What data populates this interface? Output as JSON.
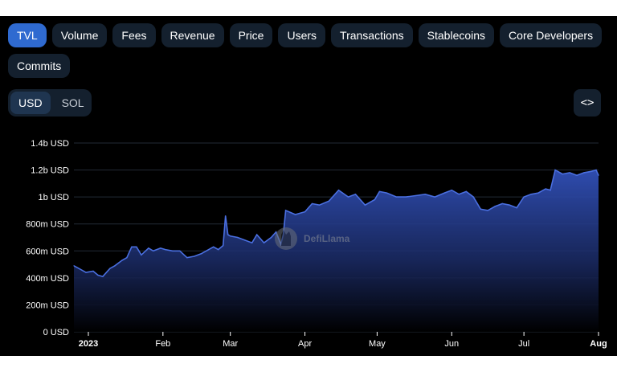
{
  "tabs": [
    {
      "label": "TVL",
      "active": true
    },
    {
      "label": "Volume",
      "active": false
    },
    {
      "label": "Fees",
      "active": false
    },
    {
      "label": "Revenue",
      "active": false
    },
    {
      "label": "Price",
      "active": false
    },
    {
      "label": "Users",
      "active": false
    },
    {
      "label": "Transactions",
      "active": false
    },
    {
      "label": "Stablecoins",
      "active": false
    },
    {
      "label": "Core Developers",
      "active": false
    },
    {
      "label": "Commits",
      "active": false
    }
  ],
  "currency_toggle": {
    "options": [
      "USD",
      "SOL"
    ],
    "selected": "USD"
  },
  "embed_icon": "code-brackets-icon",
  "watermark": {
    "text": "DefiLlama",
    "icon": "llama-logo-icon"
  },
  "colors": {
    "accent": "#2f6ad0",
    "line": "#4a6fe0",
    "fill_top": "#3150b8",
    "grid": "#222a36"
  },
  "chart_data": {
    "type": "area",
    "title": "",
    "xlabel": "",
    "ylabel": "",
    "ylim": [
      0,
      1.4
    ],
    "y_ticks": [
      {
        "value": 0,
        "label": "0 USD"
      },
      {
        "value": 0.2,
        "label": "200m USD"
      },
      {
        "value": 0.4,
        "label": "400m USD"
      },
      {
        "value": 0.6,
        "label": "600m USD"
      },
      {
        "value": 0.8,
        "label": "800m USD"
      },
      {
        "value": 1.0,
        "label": "1b USD"
      },
      {
        "value": 1.2,
        "label": "1.2b USD"
      },
      {
        "value": 1.4,
        "label": "1.4b USD"
      }
    ],
    "y_unit": "billion USD",
    "xlim": [
      "2022-12-26",
      "2023-08-01"
    ],
    "x_ticks": [
      {
        "date": "2023-01-01",
        "label": "2023",
        "bold": true
      },
      {
        "date": "2023-02-01",
        "label": "Feb"
      },
      {
        "date": "2023-03-01",
        "label": "Mar"
      },
      {
        "date": "2023-04-01",
        "label": "Apr"
      },
      {
        "date": "2023-05-01",
        "label": "May"
      },
      {
        "date": "2023-06-01",
        "label": "Jun"
      },
      {
        "date": "2023-07-01",
        "label": "Jul"
      },
      {
        "date": "2023-08-01",
        "label": "Aug",
        "bold": true
      }
    ],
    "grid": true,
    "series": [
      {
        "name": "",
        "x": [
          "2022-12-26",
          "2022-12-28",
          "2022-12-31",
          "2023-01-03",
          "2023-01-05",
          "2023-01-07",
          "2023-01-10",
          "2023-01-12",
          "2023-01-15",
          "2023-01-17",
          "2023-01-19",
          "2023-01-21",
          "2023-01-23",
          "2023-01-26",
          "2023-01-28",
          "2023-01-31",
          "2023-02-02",
          "2023-02-05",
          "2023-02-08",
          "2023-02-11",
          "2023-02-14",
          "2023-02-17",
          "2023-02-19",
          "2023-02-22",
          "2023-02-24",
          "2023-02-26",
          "2023-02-27",
          "2023-02-28",
          "2023-03-01",
          "2023-03-04",
          "2023-03-07",
          "2023-03-10",
          "2023-03-12",
          "2023-03-15",
          "2023-03-18",
          "2023-03-20",
          "2023-03-22",
          "2023-03-23",
          "2023-03-24",
          "2023-03-28",
          "2023-04-01",
          "2023-04-04",
          "2023-04-07",
          "2023-04-11",
          "2023-04-15",
          "2023-04-19",
          "2023-04-22",
          "2023-04-26",
          "2023-04-30",
          "2023-05-02",
          "2023-05-05",
          "2023-05-09",
          "2023-05-13",
          "2023-05-17",
          "2023-05-21",
          "2023-05-25",
          "2023-05-29",
          "2023-06-01",
          "2023-06-04",
          "2023-06-07",
          "2023-06-10",
          "2023-06-13",
          "2023-06-16",
          "2023-06-19",
          "2023-06-22",
          "2023-06-25",
          "2023-06-28",
          "2023-07-01",
          "2023-07-04",
          "2023-07-07",
          "2023-07-10",
          "2023-07-12",
          "2023-07-14",
          "2023-07-17",
          "2023-07-20",
          "2023-07-23",
          "2023-07-26",
          "2023-07-29",
          "2023-07-31",
          "2023-08-01"
        ],
        "values": [
          0.49,
          0.47,
          0.44,
          0.45,
          0.42,
          0.41,
          0.47,
          0.49,
          0.53,
          0.55,
          0.63,
          0.63,
          0.57,
          0.62,
          0.6,
          0.62,
          0.61,
          0.6,
          0.6,
          0.55,
          0.56,
          0.58,
          0.6,
          0.63,
          0.61,
          0.64,
          0.86,
          0.72,
          0.71,
          0.7,
          0.68,
          0.66,
          0.72,
          0.66,
          0.7,
          0.74,
          0.65,
          0.72,
          0.9,
          0.87,
          0.89,
          0.95,
          0.94,
          0.97,
          1.05,
          1.0,
          1.02,
          0.94,
          0.98,
          1.04,
          1.03,
          1.0,
          1.0,
          1.01,
          1.02,
          1.0,
          1.03,
          1.05,
          1.02,
          1.04,
          1.0,
          0.91,
          0.9,
          0.93,
          0.95,
          0.94,
          0.92,
          1.0,
          1.02,
          1.03,
          1.06,
          1.05,
          1.2,
          1.17,
          1.18,
          1.16,
          1.18,
          1.19,
          1.2,
          1.16
        ]
      }
    ]
  }
}
